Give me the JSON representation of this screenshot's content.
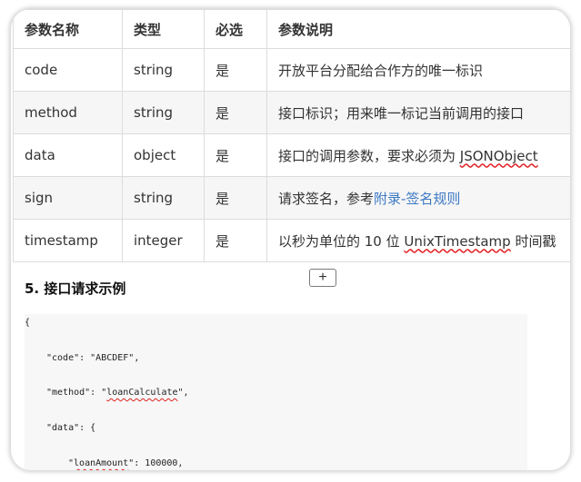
{
  "table": {
    "headers": [
      "参数名称",
      "类型",
      "必选",
      "参数说明"
    ],
    "rows": [
      {
        "name": "code",
        "type": "string",
        "required": "是",
        "desc": "开放平台分配给合作方的唯一标识"
      },
      {
        "name": "method",
        "type": "string",
        "required": "是",
        "desc": "接口标识；用来唯一标记当前调用的接口"
      },
      {
        "name": "data",
        "type": "object",
        "required": "是",
        "desc_prefix": "接口的调用参数，要求必须为 ",
        "desc_term": "JSONObject"
      },
      {
        "name": "sign",
        "type": "string",
        "required": "是",
        "desc_prefix": "请求签名，参考",
        "desc_link": "附录-签名规则"
      },
      {
        "name": "timestamp",
        "type": "integer",
        "required": "是",
        "desc_prefix": "以秒为单位的 10 位 ",
        "desc_term": "UnixTimestamp",
        "desc_suffix": " 时间戳"
      }
    ]
  },
  "add_button": {
    "label": "+"
  },
  "section": {
    "title": "5. 接口请求示例"
  },
  "code_sample": {
    "line1": "{",
    "line2_key": "\"code\"",
    "line2_rest": ": \"ABCDEF\",",
    "line3_key": "\"method\"",
    "line3_sep": ": \"",
    "line3_val": "loanCalculate",
    "line3_end": "\",",
    "line4_key": "\"data\"",
    "line4_rest": ": {",
    "line5_q": "\"",
    "line5_key": "loanAmount",
    "line5_rest": "\": 100000,"
  }
}
